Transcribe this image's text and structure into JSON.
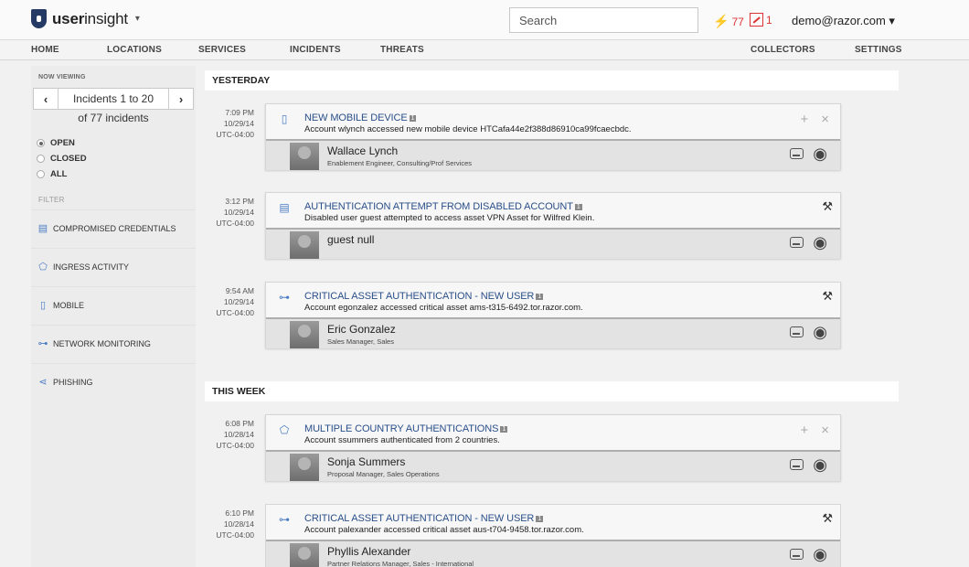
{
  "app": {
    "brand_bold": "user",
    "brand_light": "insight",
    "brand_caret": "▾"
  },
  "search": {
    "placeholder": "Search"
  },
  "indicators": {
    "alerts_count": "77",
    "reports_count": "1"
  },
  "user": {
    "email": "demo@razor.com ▾"
  },
  "nav": {
    "home": "HOME",
    "locations": "LOCATIONS",
    "services": "SERVICES",
    "incidents": "INCIDENTS",
    "threats": "THREATS",
    "collectors": "COLLECTORS",
    "settings": "SETTINGS"
  },
  "sidebar": {
    "now_viewing": "NOW VIEWING",
    "pager_prev": "‹",
    "pager_next": "›",
    "pager_label": "Incidents 1 to 20",
    "pager_sub": "of 77 incidents",
    "status": {
      "open": "OPEN",
      "closed": "CLOSED",
      "all": "ALL"
    },
    "filter_label": "FILTER",
    "filters": {
      "compromised": "COMPROMISED CREDENTIALS",
      "ingress": "INGRESS ACTIVITY",
      "mobile": "MOBILE",
      "network": "NETWORK MONITORING",
      "phishing": "PHISHING"
    }
  },
  "sections": {
    "yesterday": "YESTERDAY",
    "this_week": "THIS WEEK"
  },
  "incidents": [
    {
      "time": "7:09 PM",
      "date": "10/29/14",
      "tz": "UTC-04:00",
      "icon": "mobile-icon",
      "title": "NEW MOBILE DEVICE",
      "badge": "1",
      "desc": "Account wlynch accessed new mobile device HTCafa44e2f388d86910ca99fcaecbdc.",
      "name": "Wallace Lynch",
      "role": "Enablement Engineer, Consulting/Prof Services"
    },
    {
      "time": "3:12 PM",
      "date": "10/29/14",
      "tz": "UTC-04:00",
      "icon": "credentials-icon",
      "title": "AUTHENTICATION ATTEMPT FROM DISABLED ACCOUNT",
      "badge": "1",
      "desc": "Disabled user guest attempted to access asset VPN Asset for Wilfred Klein.",
      "name": "guest null",
      "role": ""
    },
    {
      "time": "9:54 AM",
      "date": "10/29/14",
      "tz": "UTC-04:00",
      "icon": "network-icon",
      "title": "CRITICAL ASSET AUTHENTICATION - NEW USER",
      "badge": "1",
      "desc": "Account egonzalez accessed critical asset ams-t315-6492.tor.razor.com.",
      "name": "Eric Gonzalez",
      "role": "Sales Manager, Sales"
    },
    {
      "time": "6:08 PM",
      "date": "10/28/14",
      "tz": "UTC-04:00",
      "icon": "ingress-icon",
      "title": "MULTIPLE COUNTRY AUTHENTICATIONS",
      "badge": "1",
      "desc": "Account ssummers authenticated from 2 countries.",
      "name": "Sonja Summers",
      "role": "Proposal Manager, Sales Operations"
    },
    {
      "time": "6:10 PM",
      "date": "10/28/14",
      "tz": "UTC-04:00",
      "icon": "network-icon",
      "title": "CRITICAL ASSET AUTHENTICATION - NEW USER",
      "badge": "1",
      "desc": "Account palexander accessed critical asset aus-t704-9458.tor.razor.com.",
      "name": "Phyllis Alexander",
      "role": "Partner Relations Manager, Sales - International"
    }
  ]
}
